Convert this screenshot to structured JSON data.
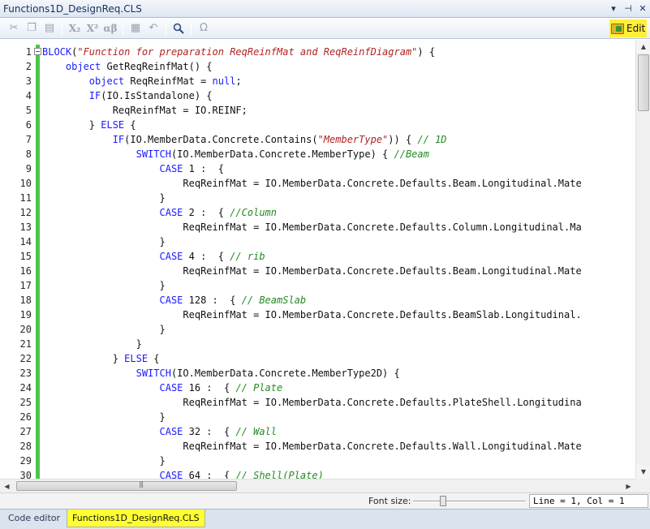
{
  "window": {
    "title": "Functions1D_DesignReq.CLS",
    "dropdown_icon": "chevron-down-icon",
    "pin_icon": "pin-icon",
    "close_icon": "close-icon"
  },
  "toolbar": {
    "buttons": [
      {
        "name": "cut-icon",
        "glyph": "✂"
      },
      {
        "name": "copy-icon",
        "glyph": "❐"
      },
      {
        "name": "paste-icon",
        "glyph": "▤"
      },
      {
        "name": "subscript-icon",
        "glyph": "X₂"
      },
      {
        "name": "superscript-icon",
        "glyph": "X²"
      },
      {
        "name": "greek-icon",
        "glyph": "αβ"
      },
      {
        "name": "document-icon",
        "glyph": "▦"
      },
      {
        "name": "undo-icon",
        "glyph": "↶"
      },
      {
        "name": "search-icon",
        "glyph": "🔍"
      },
      {
        "name": "omega-icon",
        "glyph": "Ω"
      }
    ],
    "edit_label": "Edit",
    "edit_icon": "folder-edit-icon"
  },
  "code": {
    "lines": [
      {
        "n": "1",
        "indent": 0,
        "parts": [
          [
            "kw",
            "BLOCK"
          ],
          [
            "",
            "("
          ],
          [
            "str",
            "\"Function for preparation ReqReinfMat and ReqReinfDiagram\""
          ],
          [
            "",
            ") {"
          ]
        ]
      },
      {
        "n": "2",
        "indent": 1,
        "parts": [
          [
            "kw",
            "object"
          ],
          [
            "",
            " GetReqReinfMat() {"
          ]
        ]
      },
      {
        "n": "3",
        "indent": 2,
        "parts": [
          [
            "kw",
            "object"
          ],
          [
            "",
            " ReqReinfMat = "
          ],
          [
            "kw",
            "null"
          ],
          [
            "",
            ";"
          ]
        ]
      },
      {
        "n": "4",
        "indent": 2,
        "parts": [
          [
            "kw",
            "IF"
          ],
          [
            "",
            "(IO.IsStandalone) {"
          ]
        ]
      },
      {
        "n": "5",
        "indent": 3,
        "parts": [
          [
            "",
            "ReqReinfMat = IO.REINF;"
          ]
        ]
      },
      {
        "n": "6",
        "indent": 2,
        "parts": [
          [
            "",
            "} "
          ],
          [
            "kw",
            "ELSE"
          ],
          [
            "",
            " {"
          ]
        ]
      },
      {
        "n": "7",
        "indent": 3,
        "parts": [
          [
            "kw",
            "IF"
          ],
          [
            "",
            "(IO.MemberData.Concrete.Contains("
          ],
          [
            "str",
            "\"MemberType\""
          ],
          [
            "",
            ")) { "
          ],
          [
            "cm",
            "// 1D"
          ]
        ]
      },
      {
        "n": "8",
        "indent": 4,
        "parts": [
          [
            "kw",
            "SWITCH"
          ],
          [
            "",
            "(IO.MemberData.Concrete.MemberType) { "
          ],
          [
            "cm",
            "//Beam"
          ]
        ]
      },
      {
        "n": "9",
        "indent": 5,
        "parts": [
          [
            "kw",
            "CASE"
          ],
          [
            "",
            " 1 :  {"
          ]
        ]
      },
      {
        "n": "10",
        "indent": 6,
        "parts": [
          [
            "",
            "ReqReinfMat = IO.MemberData.Concrete.Defaults.Beam.Longitudinal.Mate"
          ]
        ]
      },
      {
        "n": "11",
        "indent": 5,
        "parts": [
          [
            "",
            "}"
          ]
        ]
      },
      {
        "n": "12",
        "indent": 5,
        "parts": [
          [
            "kw",
            "CASE"
          ],
          [
            "",
            " 2 :  { "
          ],
          [
            "cm",
            "//Column"
          ]
        ]
      },
      {
        "n": "13",
        "indent": 6,
        "parts": [
          [
            "",
            "ReqReinfMat = IO.MemberData.Concrete.Defaults.Column.Longitudinal.Ma"
          ]
        ]
      },
      {
        "n": "14",
        "indent": 5,
        "parts": [
          [
            "",
            "}"
          ]
        ]
      },
      {
        "n": "15",
        "indent": 5,
        "parts": [
          [
            "kw",
            "CASE"
          ],
          [
            "",
            " 4 :  { "
          ],
          [
            "cm",
            "// rib"
          ]
        ]
      },
      {
        "n": "16",
        "indent": 6,
        "parts": [
          [
            "",
            "ReqReinfMat = IO.MemberData.Concrete.Defaults.Beam.Longitudinal.Mate"
          ]
        ]
      },
      {
        "n": "17",
        "indent": 5,
        "parts": [
          [
            "",
            "}"
          ]
        ]
      },
      {
        "n": "18",
        "indent": 5,
        "parts": [
          [
            "kw",
            "CASE"
          ],
          [
            "",
            " 128 :  { "
          ],
          [
            "cm",
            "// BeamSlab"
          ]
        ]
      },
      {
        "n": "19",
        "indent": 6,
        "parts": [
          [
            "",
            "ReqReinfMat = IO.MemberData.Concrete.Defaults.BeamSlab.Longitudinal."
          ]
        ]
      },
      {
        "n": "20",
        "indent": 5,
        "parts": [
          [
            "",
            "}"
          ]
        ]
      },
      {
        "n": "21",
        "indent": 4,
        "parts": [
          [
            "",
            "}"
          ]
        ]
      },
      {
        "n": "22",
        "indent": 3,
        "parts": [
          [
            "",
            "} "
          ],
          [
            "kw",
            "ELSE"
          ],
          [
            "",
            " {"
          ]
        ]
      },
      {
        "n": "23",
        "indent": 4,
        "parts": [
          [
            "kw",
            "SWITCH"
          ],
          [
            "",
            "(IO.MemberData.Concrete.MemberType2D) {"
          ]
        ]
      },
      {
        "n": "24",
        "indent": 5,
        "parts": [
          [
            "kw",
            "CASE"
          ],
          [
            "",
            " 16 :  { "
          ],
          [
            "cm",
            "// Plate"
          ]
        ]
      },
      {
        "n": "25",
        "indent": 6,
        "parts": [
          [
            "",
            "ReqReinfMat = IO.MemberData.Concrete.Defaults.PlateShell.Longitudina"
          ]
        ]
      },
      {
        "n": "26",
        "indent": 5,
        "parts": [
          [
            "",
            "}"
          ]
        ]
      },
      {
        "n": "27",
        "indent": 5,
        "parts": [
          [
            "kw",
            "CASE"
          ],
          [
            "",
            " 32 :  { "
          ],
          [
            "cm",
            "// Wall"
          ]
        ]
      },
      {
        "n": "28",
        "indent": 6,
        "parts": [
          [
            "",
            "ReqReinfMat = IO.MemberData.Concrete.Defaults.Wall.Longitudinal.Mate"
          ]
        ]
      },
      {
        "n": "29",
        "indent": 5,
        "parts": [
          [
            "",
            "}"
          ]
        ]
      },
      {
        "n": "30",
        "indent": 5,
        "parts": [
          [
            "kw",
            "CASE"
          ],
          [
            "",
            " 64 :  { "
          ],
          [
            "cm",
            "// Shell(Plate)"
          ]
        ]
      }
    ]
  },
  "status": {
    "font_size_label": "Font size:",
    "font_size_level": 0.25,
    "position": "Line = 1, Col = 1"
  },
  "tabs": [
    {
      "label": "Code editor",
      "active": false
    },
    {
      "label": "Functions1D_DesignReq.CLS",
      "active": true
    }
  ],
  "colors": {
    "keyword": "#1a1aff",
    "string": "#b22222",
    "comment": "#228b22",
    "gutter_change": "#4cc54c",
    "highlight": "#ffff33"
  }
}
